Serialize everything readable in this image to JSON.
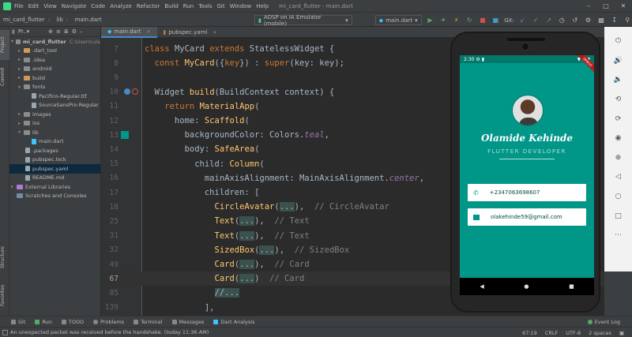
{
  "menubar": {
    "items": [
      "File",
      "Edit",
      "View",
      "Navigate",
      "Code",
      "Analyze",
      "Refactor",
      "Build",
      "Run",
      "Tools",
      "Git",
      "Window",
      "Help"
    ],
    "title": "mi_card_flutter - main.dart"
  },
  "navbar": {
    "crumbs": [
      "mi_card_flutter",
      "lib",
      "main.dart"
    ],
    "device_combo": "AOSP on IA Emulator (mobile)",
    "run_config": "main.dart",
    "git_label": "Git:"
  },
  "left_stripe": {
    "project": "Project",
    "commit": "Commit",
    "structure": "Structure",
    "favorites": "Favorites"
  },
  "project_panel": {
    "header": "Pr..▾",
    "items": [
      {
        "label": "mi_card_flutter",
        "extra": "C:\\Users\\ula",
        "icon": "folder-icon"
      },
      {
        "label": ".dart_tool",
        "icon": "folder-icon"
      },
      {
        "label": ".idea",
        "icon": "folder-icon"
      },
      {
        "label": "android",
        "icon": "folder-icon"
      },
      {
        "label": "build",
        "icon": "folder-icon"
      },
      {
        "label": "fonts",
        "icon": "folder-icon"
      },
      {
        "label": "Pacifico-Regular.ttf",
        "icon": "file-icon"
      },
      {
        "label": "SourceSansPro-Regular",
        "icon": "file-icon"
      },
      {
        "label": "images",
        "icon": "folder-icon"
      },
      {
        "label": "ios",
        "icon": "folder-icon"
      },
      {
        "label": "lib",
        "icon": "folder-icon"
      },
      {
        "label": "main.dart",
        "icon": "dart-file-icon"
      },
      {
        "label": ".packages",
        "icon": "file-icon"
      },
      {
        "label": "pubspec.lock",
        "icon": "file-icon"
      },
      {
        "label": "pubspec.yaml",
        "icon": "file-icon"
      },
      {
        "label": "README.md",
        "icon": "file-icon"
      },
      {
        "label": "External Libraries",
        "icon": "library-icon"
      },
      {
        "label": "Scratches and Consoles",
        "icon": "scratch-icon"
      }
    ]
  },
  "editor_tabs": [
    {
      "label": "main.dart",
      "icon": "dart-file-icon"
    },
    {
      "label": "pubspec.yaml",
      "icon": "yaml-file-icon"
    }
  ],
  "code": {
    "line_numbers": [
      "7",
      "8",
      "9",
      "10",
      "11",
      "12",
      "13",
      "14",
      "15",
      "16",
      "17",
      "18",
      "25",
      "31",
      "32",
      "49",
      "67",
      "85",
      "139"
    ],
    "current_line": "67"
  },
  "phone": {
    "time": "2:30",
    "debug_banner": "DEBUG",
    "name": "Olamide Kehinde",
    "role": "FLUTTER DEVELOPER",
    "phone_number": "+2347063698607",
    "email": "olakehinde59@gmail.com",
    "colors": {
      "background": "#009688",
      "card_text": "#004d40"
    }
  },
  "bottom_tools": [
    "Git",
    "Run",
    "TODO",
    "Problems",
    "Terminal",
    "Messages",
    "Dart Analysis"
  ],
  "event_log": "Event Log",
  "status": {
    "message": "An unexpected packet was received before the handshake. (today 11:36 AM)",
    "position": "67:19",
    "line_sep": "CRLF",
    "encoding": "UTF-8",
    "indent": "2 spaces"
  }
}
